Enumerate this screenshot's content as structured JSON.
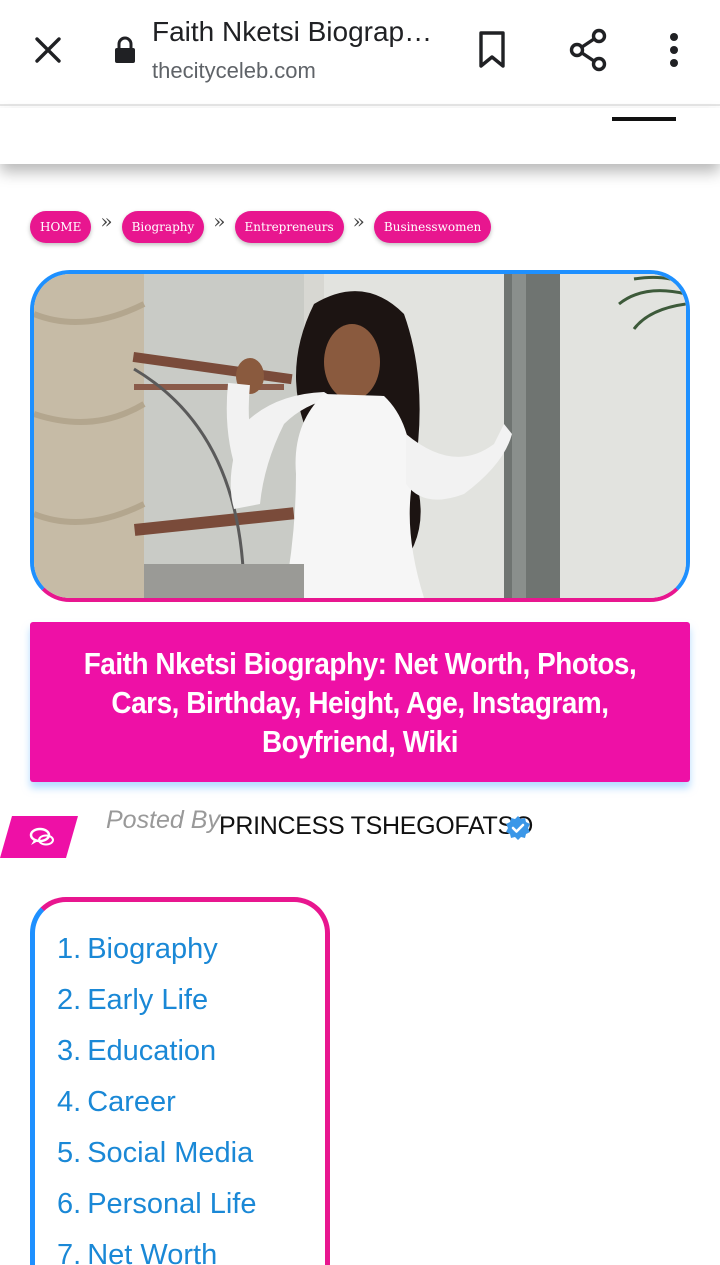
{
  "browser": {
    "title": "Faith Nketsi Biography: Net Worth, Photos, Cars, Birthday, Height, Age, Instagram, Boyfriend, Wiki",
    "url": "thecityceleb.com"
  },
  "breadcrumb": [
    "HOME",
    "Biography",
    "Entrepreneurs",
    "Businesswomen"
  ],
  "breadcrumb_separator": "»",
  "article": {
    "title": "Faith Nketsi Biography: Net Worth, Photos, Cars, Birthday, Height, Age, Instagram, Boyfriend, Wiki",
    "posted_by_label": "Posted By",
    "author": "PRINCESS TSHEGOFATSO"
  },
  "toc": [
    {
      "num": "1.",
      "label": "Biography"
    },
    {
      "num": "2.",
      "label": "Early Life"
    },
    {
      "num": "3.",
      "label": "Education"
    },
    {
      "num": "4.",
      "label": "Career"
    },
    {
      "num": "5.",
      "label": "Social Media"
    },
    {
      "num": "6.",
      "label": "Personal Life"
    },
    {
      "num": "7.",
      "label": "Net Worth"
    }
  ],
  "colors": {
    "accent_pink": "#ee10a6",
    "accent_blue": "#1e90ff",
    "link_blue": "#1a88d6"
  },
  "icons": [
    "close-icon",
    "lock-icon",
    "bookmark-icon",
    "share-icon",
    "more-vert-icon",
    "comment-icon",
    "verified-icon"
  ]
}
